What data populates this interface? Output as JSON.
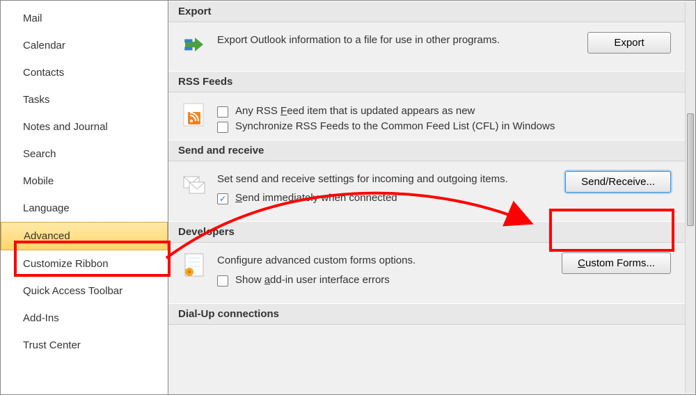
{
  "sidebar": {
    "items": [
      {
        "label": "Mail"
      },
      {
        "label": "Calendar"
      },
      {
        "label": "Contacts"
      },
      {
        "label": "Tasks"
      },
      {
        "label": "Notes and Journal"
      },
      {
        "label": "Search"
      },
      {
        "label": "Mobile"
      },
      {
        "label": "Language"
      },
      {
        "label": "Advanced"
      },
      {
        "label": "Customize Ribbon"
      },
      {
        "label": "Quick Access Toolbar"
      },
      {
        "label": "Add-Ins"
      },
      {
        "label": "Trust Center"
      }
    ]
  },
  "sections": {
    "export": {
      "title": "Export",
      "desc": "Export Outlook information to a file for use in other programs.",
      "button": "Export"
    },
    "rss": {
      "title": "RSS Feeds",
      "check1_pre": "Any RSS ",
      "check1_u": "F",
      "check1_post": "eed item that is updated appears as new",
      "check2": "Synchronize RSS Feeds to the Common Feed List (CFL) in Windows"
    },
    "send": {
      "title": "Send and receive",
      "desc": "Set send and receive settings for incoming and outgoing items.",
      "check_u": "S",
      "check_post": "end immediately when connected",
      "button": "Send/Receive..."
    },
    "dev": {
      "title": "Developers",
      "desc": "Configure advanced custom forms options.",
      "check_pre": "Show ",
      "check_u": "a",
      "check_post": "dd-in user interface errors",
      "button_u": "C",
      "button_post": "ustom Forms..."
    },
    "dial": {
      "title": "Dial-Up connections"
    }
  }
}
